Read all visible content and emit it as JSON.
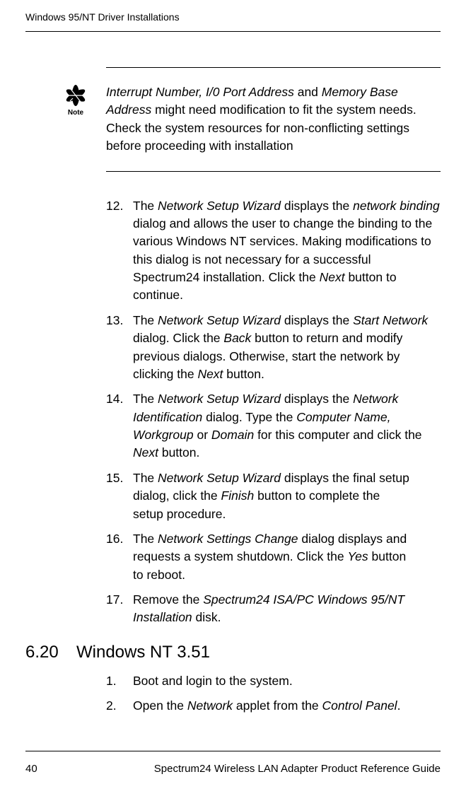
{
  "running_header": "Windows 95/NT Driver Installations",
  "note": {
    "icon_label": "Note",
    "text_parts": {
      "p1_ital": "Interrupt Number, I/0 Port Address",
      "p1_and": " and ",
      "p1_ital2": "Memory Base Address",
      "p1_rest": " might need modification to fit the system needs. Check the system resources for non-conflicting settings before proceeding with installation"
    }
  },
  "steps_cont": [
    {
      "n": "12.",
      "segs": [
        {
          "t": "The "
        },
        {
          "t": "Network Setup Wizard",
          "i": true
        },
        {
          "t": " displays the "
        },
        {
          "t": "network binding",
          "i": true
        },
        {
          "t": " dialog and allows the user to change the binding to the various Windows NT services. Making modifications to this dialog is not necessary for a successful Spectrum24 installation. Click the "
        },
        {
          "t": "Next",
          "i": true
        },
        {
          "t": " button to continue."
        }
      ]
    },
    {
      "n": "13.",
      "segs": [
        {
          "t": "The "
        },
        {
          "t": "Network Setup Wizard",
          "i": true
        },
        {
          "t": " displays the "
        },
        {
          "t": "Start Network",
          "i": true
        },
        {
          "t": " dialog. Click the "
        },
        {
          "t": "Back",
          "i": true
        },
        {
          "t": " button to return and modify previous dialogs. Otherwise, start the network by clicking the "
        },
        {
          "t": "Next",
          "i": true
        },
        {
          "t": " button."
        }
      ]
    },
    {
      "n": "14.",
      "segs": [
        {
          "t": "The "
        },
        {
          "t": "Network Setup Wizard",
          "i": true
        },
        {
          "t": " displays the "
        },
        {
          "t": "Network Identification",
          "i": true
        },
        {
          "t": " dialog. Type the "
        },
        {
          "t": "Computer Name, Workgroup",
          "i": true
        },
        {
          "t": " or "
        },
        {
          "t": "Domain",
          "i": true
        },
        {
          "t": " for this computer and click the "
        },
        {
          "t": "Next",
          "i": true
        },
        {
          "t": " button."
        }
      ]
    },
    {
      "n": "15.",
      "segs": [
        {
          "t": "The "
        },
        {
          "t": "Network Setup Wizard",
          "i": true
        },
        {
          "t": " displays the final setup dialog, click the "
        },
        {
          "t": "Finish",
          "i": true
        },
        {
          "t": " button to complete the setup procedure."
        }
      ]
    },
    {
      "n": "16.",
      "segs": [
        {
          "t": "The "
        },
        {
          "t": "Network Settings Change",
          "i": true
        },
        {
          "t": " dialog displays and requests a system shutdown. Click the "
        },
        {
          "t": "Yes",
          "i": true
        },
        {
          "t": " button to reboot."
        }
      ]
    },
    {
      "n": "17.",
      "segs": [
        {
          "t": "Remove the "
        },
        {
          "t": "Spectrum24 ISA/PC Windows 95/NT Installation",
          "i": true
        },
        {
          "t": " disk."
        }
      ]
    }
  ],
  "section": {
    "num": "6.20",
    "title": "Windows NT 3.51"
  },
  "steps_new": [
    {
      "n": "1.",
      "segs": [
        {
          "t": "Boot and login to the system."
        }
      ]
    },
    {
      "n": "2.",
      "segs": [
        {
          "t": "Open the "
        },
        {
          "t": "Network",
          "i": true
        },
        {
          "t": " applet from the "
        },
        {
          "t": "Control Panel",
          "i": true
        },
        {
          "t": "."
        }
      ]
    }
  ],
  "footer": {
    "page": "40",
    "title": "Spectrum24 Wireless LAN Adapter Product Reference Guide"
  }
}
